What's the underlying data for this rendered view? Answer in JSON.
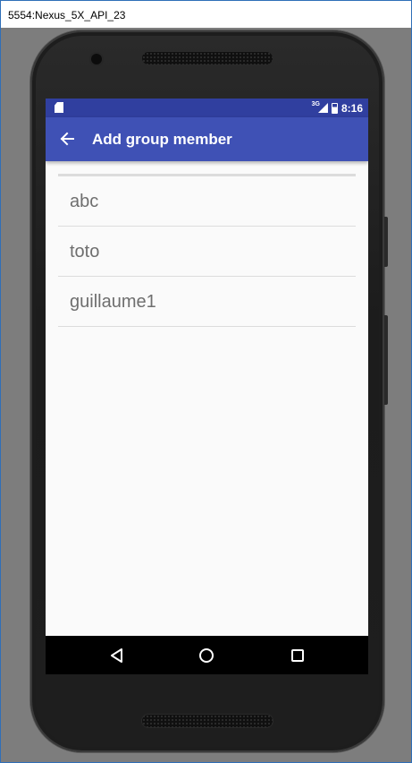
{
  "window": {
    "title": "5554:Nexus_5X_API_23"
  },
  "status_bar": {
    "network": "3G",
    "time": "8:16",
    "color": "#303f9f"
  },
  "app_bar": {
    "title": "Add group member",
    "back_icon": "arrow-left-icon",
    "color": "#3f51b5"
  },
  "members": [
    {
      "name": "abc"
    },
    {
      "name": "toto"
    },
    {
      "name": "guillaume1"
    }
  ],
  "nav_bar": {
    "back_icon": "triangle-back-icon",
    "home_icon": "circle-home-icon",
    "recents_icon": "square-recents-icon"
  }
}
